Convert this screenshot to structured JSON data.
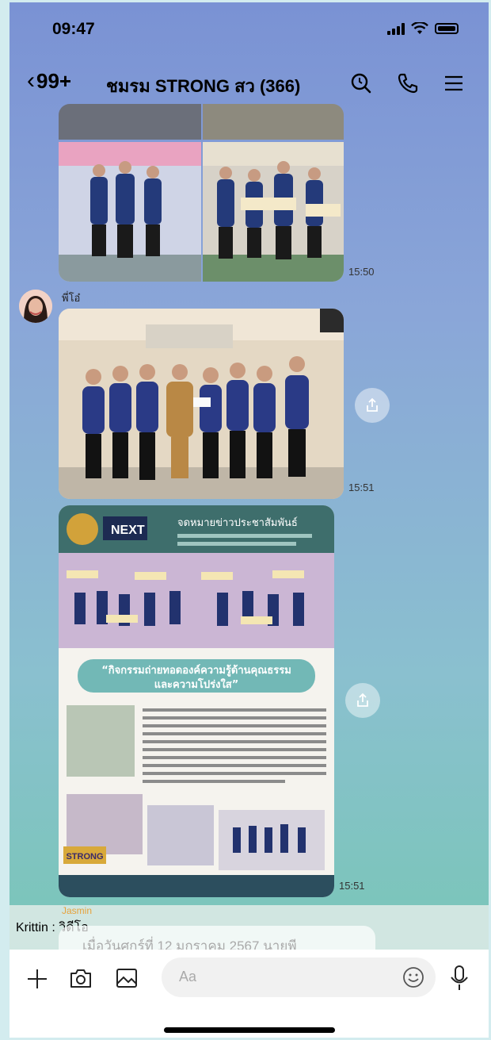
{
  "status": {
    "time": "09:47"
  },
  "header": {
    "unread": "99+",
    "title": "ชมรม STRONG สว (366)"
  },
  "icons": {
    "back": "chevron-left-icon",
    "search": "search-icon",
    "call": "phone-icon",
    "menu": "menu-icon"
  },
  "messages": [
    {
      "type": "image",
      "time": "15:50"
    },
    {
      "sender": "พี่โอ๋",
      "type": "image",
      "time": "15:51"
    },
    {
      "type": "image",
      "time": "15:51",
      "poster": {
        "brand": "NEXT",
        "headline": "จดหมายข่าวประชาสัมพันธ์",
        "banner_line1": "“กิจกรรมถ่ายทอดองค์ความรู้ด้านคุณธรรม",
        "banner_line2": "และความโปร่งใส”",
        "footer_logo": "STRONG"
      }
    }
  ],
  "reply_preview": {
    "author": "Jasmin",
    "label": "Krittin : วิดีโอ",
    "text": "เมื่อวันศุกร์ที่ 12 มกราคม 2567 นายพี"
  },
  "composer": {
    "placeholder": "Aa"
  },
  "colors": {
    "accent": "#06c755",
    "bubble_time": "#333333"
  }
}
